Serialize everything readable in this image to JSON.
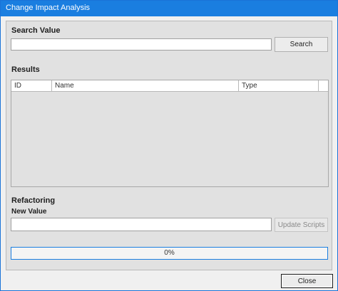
{
  "window": {
    "title": "Change Impact Analysis"
  },
  "search": {
    "section_label": "Search Value",
    "value": "",
    "button_label": "Search"
  },
  "results": {
    "section_label": "Results",
    "columns": [
      "ID",
      "Name",
      "Type"
    ]
  },
  "refactoring": {
    "section_label": "Refactoring",
    "new_value_label": "New Value",
    "value": "",
    "button_label": "Update Scripts"
  },
  "progress": {
    "percent": 0,
    "text": "0%"
  },
  "footer": {
    "close_label": "Close"
  },
  "colors": {
    "titlebar": "#1a7ee0",
    "progress_border": "#1a7ee0"
  }
}
